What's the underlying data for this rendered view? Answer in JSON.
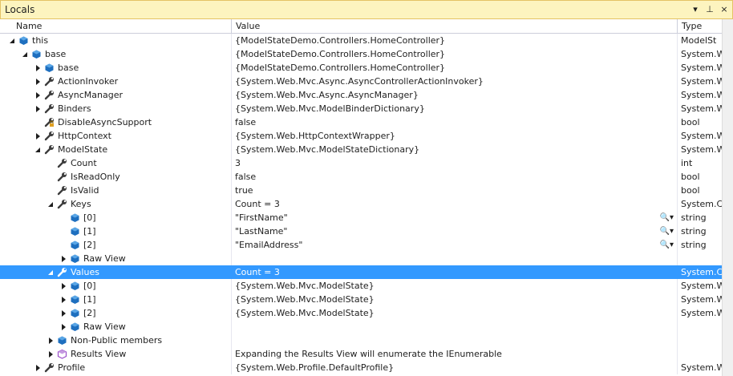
{
  "window": {
    "title": "Locals",
    "dropdown_glyph": "▾",
    "pin_glyph": "⊥",
    "close_glyph": "×"
  },
  "columns": {
    "name": "Name",
    "value": "Value",
    "type": "Type"
  },
  "icons": {
    "search": "🔍",
    "chevron": "▾"
  },
  "colors": {
    "selection": "#3399ff",
    "titlebar": "#fdf4bf",
    "object_icon": "#1e6fbf",
    "results_icon": "#9b4dca"
  },
  "rows": [
    {
      "level": 0,
      "expander": "expanded",
      "icon": "object",
      "name": "this",
      "value": "{ModelStateDemo.Controllers.HomeController}",
      "type": "ModelSt"
    },
    {
      "level": 1,
      "expander": "expanded",
      "icon": "object",
      "name": "base",
      "value": "{ModelStateDemo.Controllers.HomeController}",
      "type": "System.W"
    },
    {
      "level": 2,
      "expander": "collapsed",
      "icon": "object",
      "name": "base",
      "value": "{ModelStateDemo.Controllers.HomeController}",
      "type": "System.W"
    },
    {
      "level": 2,
      "expander": "collapsed",
      "icon": "wrench",
      "name": "ActionInvoker",
      "value": "{System.Web.Mvc.Async.AsyncControllerActionInvoker}",
      "type": "System.W"
    },
    {
      "level": 2,
      "expander": "collapsed",
      "icon": "wrench",
      "name": "AsyncManager",
      "value": "{System.Web.Mvc.Async.AsyncManager}",
      "type": "System.W"
    },
    {
      "level": 2,
      "expander": "collapsed",
      "icon": "wrench",
      "name": "Binders",
      "value": "{System.Web.Mvc.ModelBinderDictionary}",
      "type": "System.W"
    },
    {
      "level": 2,
      "expander": "none",
      "icon": "wrench-private",
      "name": "DisableAsyncSupport",
      "value": "false",
      "type": "bool"
    },
    {
      "level": 2,
      "expander": "collapsed",
      "icon": "wrench",
      "name": "HttpContext",
      "value": "{System.Web.HttpContextWrapper}",
      "type": "System.W"
    },
    {
      "level": 2,
      "expander": "expanded",
      "icon": "wrench",
      "name": "ModelState",
      "value": "{System.Web.Mvc.ModelStateDictionary}",
      "type": "System.W"
    },
    {
      "level": 3,
      "expander": "none",
      "icon": "wrench",
      "name": "Count",
      "value": "3",
      "type": "int"
    },
    {
      "level": 3,
      "expander": "none",
      "icon": "wrench",
      "name": "IsReadOnly",
      "value": "false",
      "type": "bool"
    },
    {
      "level": 3,
      "expander": "none",
      "icon": "wrench",
      "name": "IsValid",
      "value": "true",
      "type": "bool"
    },
    {
      "level": 3,
      "expander": "expanded",
      "icon": "wrench",
      "name": "Keys",
      "value": "Count = 3",
      "type": "System.C"
    },
    {
      "level": 4,
      "expander": "none",
      "icon": "object",
      "name": "[0]",
      "value": "\"FirstName\"",
      "type": "string",
      "viz": true
    },
    {
      "level": 4,
      "expander": "none",
      "icon": "object",
      "name": "[1]",
      "value": "\"LastName\"",
      "type": "string",
      "viz": true
    },
    {
      "level": 4,
      "expander": "none",
      "icon": "object",
      "name": "[2]",
      "value": "\"EmailAddress\"",
      "type": "string",
      "viz": true
    },
    {
      "level": 4,
      "expander": "collapsed",
      "icon": "object",
      "name": "Raw View",
      "value": "",
      "type": ""
    },
    {
      "level": 3,
      "expander": "expanded",
      "icon": "wrench",
      "name": "Values",
      "value": "Count = 3",
      "type": "System.C",
      "selected": true
    },
    {
      "level": 4,
      "expander": "collapsed",
      "icon": "object",
      "name": "[0]",
      "value": "{System.Web.Mvc.ModelState}",
      "type": "System.W"
    },
    {
      "level": 4,
      "expander": "collapsed",
      "icon": "object",
      "name": "[1]",
      "value": "{System.Web.Mvc.ModelState}",
      "type": "System.W"
    },
    {
      "level": 4,
      "expander": "collapsed",
      "icon": "object",
      "name": "[2]",
      "value": "{System.Web.Mvc.ModelState}",
      "type": "System.W"
    },
    {
      "level": 4,
      "expander": "collapsed",
      "icon": "object",
      "name": "Raw View",
      "value": "",
      "type": ""
    },
    {
      "level": 3,
      "expander": "collapsed",
      "icon": "object",
      "name": "Non-Public members",
      "value": "",
      "type": ""
    },
    {
      "level": 3,
      "expander": "collapsed",
      "icon": "results",
      "name": "Results View",
      "value": "Expanding the Results View will enumerate the IEnumerable",
      "type": ""
    },
    {
      "level": 2,
      "expander": "collapsed",
      "icon": "wrench",
      "name": "Profile",
      "value": "{System.Web.Profile.DefaultProfile}",
      "type": "System.W"
    }
  ]
}
